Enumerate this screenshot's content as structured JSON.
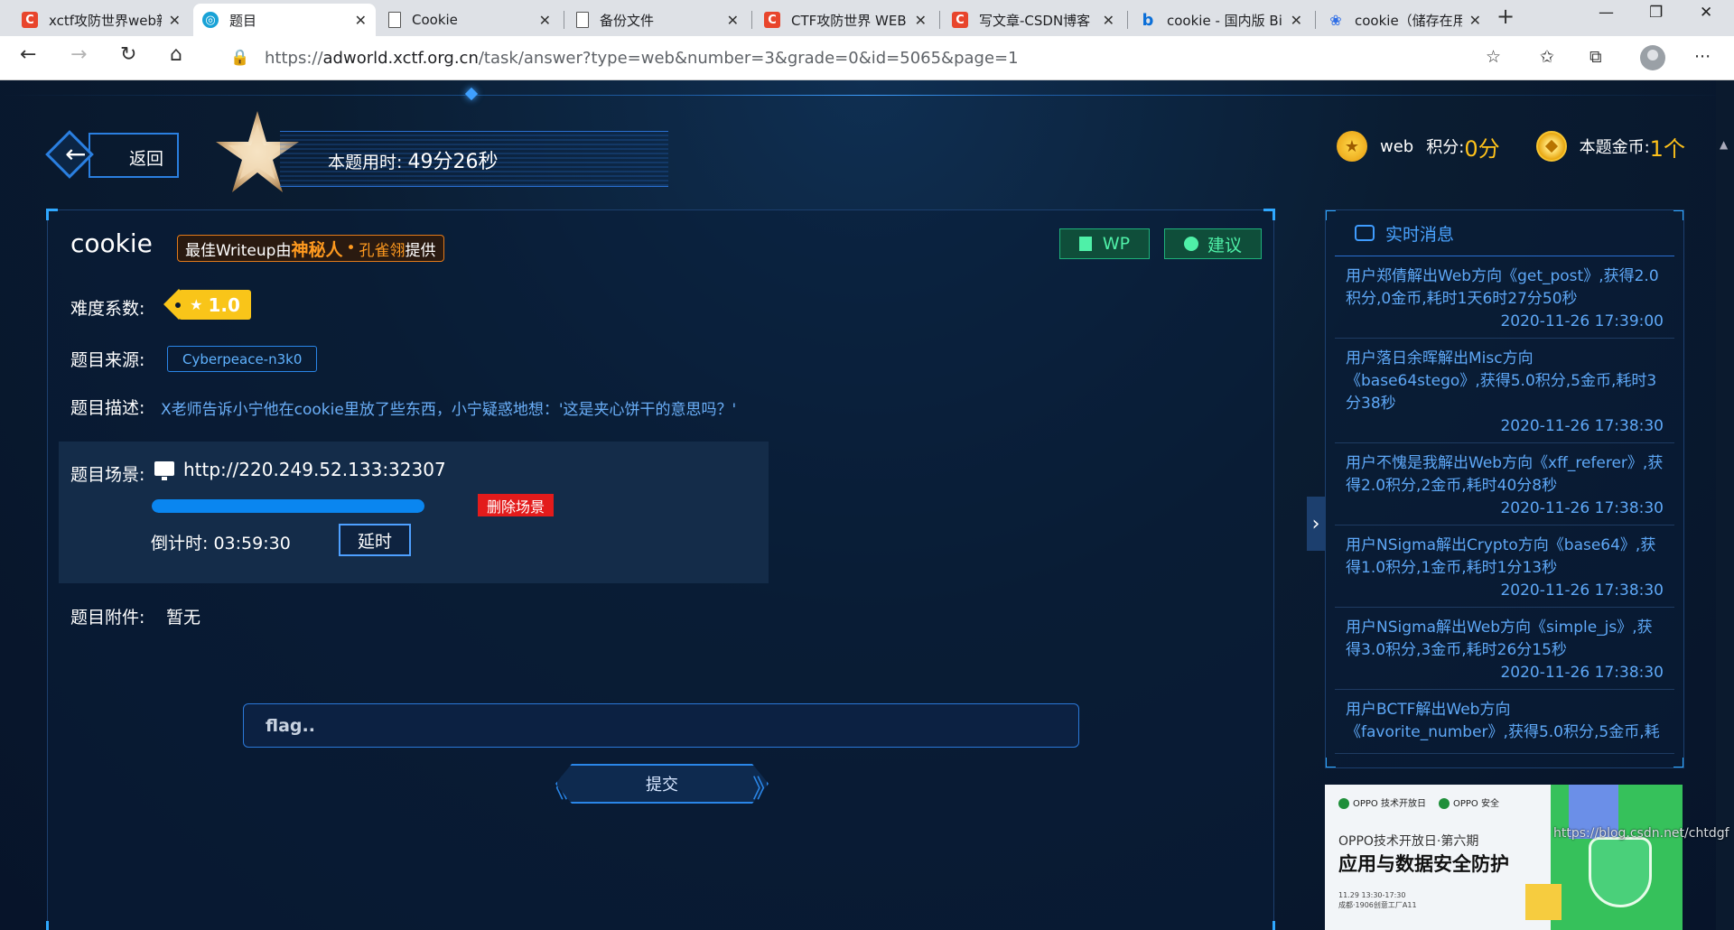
{
  "browser": {
    "tabs": [
      {
        "title": "xctf攻防世界web新",
        "icon": "csdn-icon",
        "active": false
      },
      {
        "title": "题目",
        "icon": "xctf-icon",
        "active": true
      },
      {
        "title": "Cookie",
        "icon": "page-icon",
        "active": false
      },
      {
        "title": "备份文件",
        "icon": "page-icon",
        "active": false
      },
      {
        "title": "CTF攻防世界 WEB",
        "icon": "csdn-icon",
        "active": false
      },
      {
        "title": "写文章-CSDN博客",
        "icon": "csdn-icon",
        "active": false
      },
      {
        "title": "cookie - 国内版 Bi",
        "icon": "bing-icon",
        "active": false
      },
      {
        "title": "cookie（储存在用",
        "icon": "baidu-icon",
        "active": false
      }
    ],
    "url_prefix": "https://",
    "url_host": "adworld.xctf.org.cn",
    "url_path": "/task/answer?type=web&number=3&grade=0&id=5065&page=1"
  },
  "header": {
    "back_label": "返回",
    "timer_label": "本题用时:",
    "timer_value": "49分26秒",
    "category": "web",
    "score_label": "积分:",
    "score_value": "0分",
    "coins_label": "本题金币:",
    "coins_value": "1个"
  },
  "task": {
    "title": "cookie",
    "wp_prefix": "最佳Writeup由",
    "wp_author": "神秘人",
    "wp_dot": "•",
    "wp_author2": "孔雀翎",
    "wp_suffix": "提供",
    "wp_button": "WP",
    "suggest_button": "建议",
    "difficulty_label": "难度系数:",
    "difficulty_value": "1.0",
    "source_label": "题目来源:",
    "source_value": "Cyberpeace-n3k0",
    "desc_label": "题目描述:",
    "desc_value": "X老师告诉小宁他在cookie里放了些东西，小宁疑惑地想：'这是夹心饼干的意思吗？'",
    "scene_label": "题目场景:",
    "scene_url": "http://220.249.52.133:32307",
    "scene_progress": 1.0,
    "delete_button": "删除场景",
    "countdown_label": "倒计时:",
    "countdown_value": "03:59:30",
    "extend_button": "延时",
    "attach_label": "题目附件:",
    "attach_value": "暂无",
    "flag_placeholder": "flag..",
    "submit_button": "提交"
  },
  "news": {
    "title": "实时消息",
    "items": [
      {
        "text": "用户郑倩解出Web方向《get_post》,获得2.0积分,0金币,耗时1天6时27分50秒",
        "time": "2020-11-26 17:39:00"
      },
      {
        "text": "用户落日余晖解出Misc方向《base64stego》,获得5.0积分,5金币,耗时3分38秒",
        "time": "2020-11-26 17:38:30"
      },
      {
        "text": "用户不愧是我解出Web方向《xff_referer》,获得2.0积分,2金币,耗时40分8秒",
        "time": "2020-11-26 17:38:30"
      },
      {
        "text": "用户NSigma解出Crypto方向《base64》,获得1.0积分,1金币,耗时1分13秒",
        "time": "2020-11-26 17:38:30"
      },
      {
        "text": "用户NSigma解出Web方向《simple_js》,获得3.0积分,3金币,耗时26分15秒",
        "time": "2020-11-26 17:38:30"
      },
      {
        "text": "用户BCTF解出Web方向《favorite_number》,获得5.0积分,5金币,耗",
        "time": ""
      }
    ]
  },
  "ad": {
    "logo1": "OPPO 技术开放日",
    "logo2": "OPPO 安全",
    "line1": "OPPO技术开放日·第六期",
    "line2": "应用与数据安全防护",
    "detail1": "11.29  13:30-17:30",
    "detail2": "成都·1906创意工厂A11"
  },
  "watermark": "https://blog.csdn.net/chtdgf"
}
